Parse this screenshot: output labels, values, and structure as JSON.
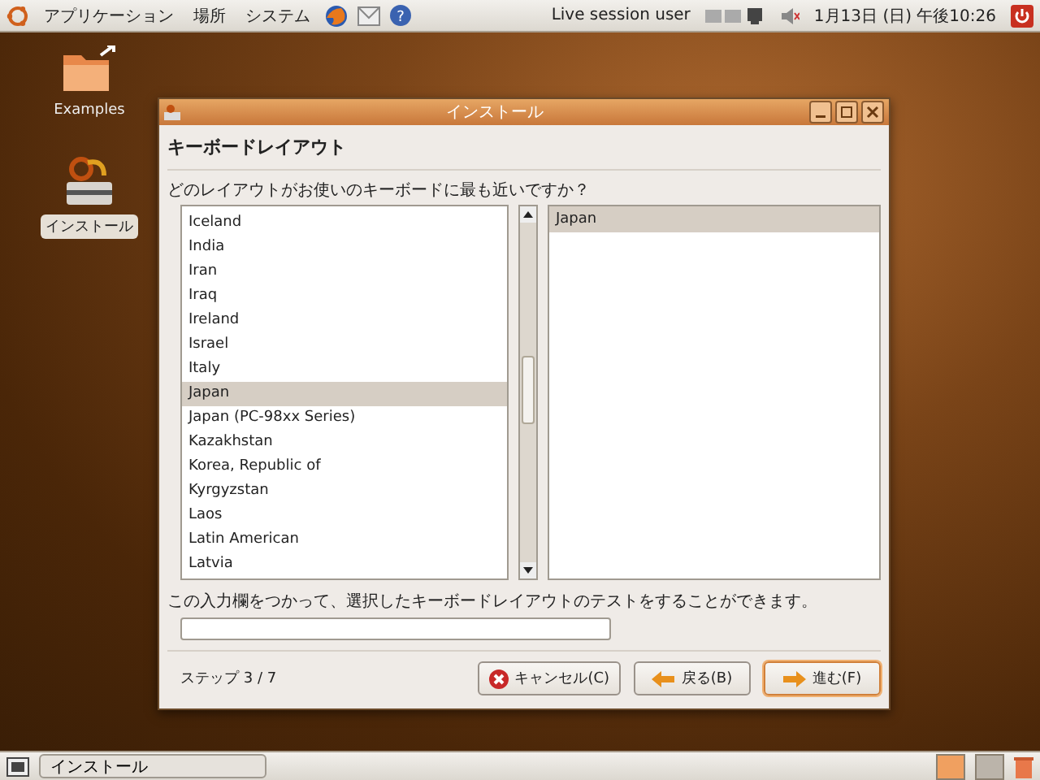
{
  "top_panel": {
    "menus": [
      "アプリケーション",
      "場所",
      "システム"
    ],
    "user": "Live session user",
    "clock": "1月13日 (日) 午後10:26",
    "help_glyph": "?"
  },
  "desktop_icons": [
    {
      "kind": "folder",
      "label": "Examples",
      "selected": false
    },
    {
      "kind": "installer",
      "label": "インストール",
      "selected": true
    }
  ],
  "window": {
    "title": "インストール",
    "heading": "キーボードレイアウト",
    "question": "どのレイアウトがお使いのキーボードに最も近いですか？",
    "layouts": [
      {
        "label": "Iceland",
        "selected": false
      },
      {
        "label": "India",
        "selected": false
      },
      {
        "label": "Iran",
        "selected": false
      },
      {
        "label": "Iraq",
        "selected": false
      },
      {
        "label": "Ireland",
        "selected": false
      },
      {
        "label": "Israel",
        "selected": false
      },
      {
        "label": "Italy",
        "selected": false
      },
      {
        "label": "Japan",
        "selected": true
      },
      {
        "label": "Japan (PC-98xx Series)",
        "selected": false
      },
      {
        "label": "Kazakhstan",
        "selected": false
      },
      {
        "label": "Korea, Republic of",
        "selected": false
      },
      {
        "label": "Kyrgyzstan",
        "selected": false
      },
      {
        "label": "Laos",
        "selected": false
      },
      {
        "label": "Latin American",
        "selected": false
      },
      {
        "label": "Latvia",
        "selected": false
      }
    ],
    "variants": [
      {
        "label": "Japan",
        "selected": true
      }
    ],
    "test_hint": "この入力欄をつかって、選択したキーボードレイアウトのテストをすることができます。",
    "step": "ステップ 3 / 7",
    "buttons": [
      {
        "kind": "cancel",
        "label": "キャンセル(C)"
      },
      {
        "kind": "back",
        "label": "戻る(B)"
      },
      {
        "kind": "forward",
        "label": "進む(F)"
      }
    ]
  },
  "taskbar": {
    "tasks": [
      {
        "label": "インストール",
        "selected": false
      }
    ]
  }
}
